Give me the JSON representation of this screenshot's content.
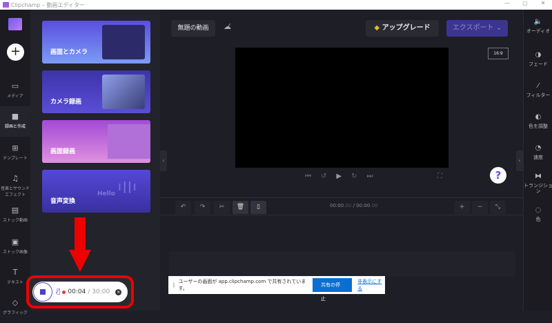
{
  "window": {
    "title": "Clipchamp – 動画エディター",
    "minimize": "—",
    "maximize": "▢",
    "close": "✕"
  },
  "nav": {
    "add": "+",
    "items": [
      {
        "label": "メディア",
        "icon": "▭"
      },
      {
        "label": "録画と作成",
        "icon": "■"
      },
      {
        "label": "テンプレート",
        "icon": "⊞"
      },
      {
        "label": "音楽とサウンドエフェクト",
        "icon": "♫"
      },
      {
        "label": "ストック動画",
        "icon": "▤"
      },
      {
        "label": "ストック画像",
        "icon": "▣"
      },
      {
        "label": "テキスト",
        "icon": "T"
      },
      {
        "label": "グラフィック",
        "icon": "◇"
      }
    ]
  },
  "panel": {
    "cards": [
      {
        "label": "画面とカメラ"
      },
      {
        "label": "カメラ録画"
      },
      {
        "label": "画面録画"
      },
      {
        "label": "音声変換",
        "thumb_text": "Hello"
      }
    ]
  },
  "header": {
    "project_title": "無題の動画",
    "upgrade": "アップグレード",
    "export": "エクスポート",
    "export_chevron": "⌄"
  },
  "preview": {
    "aspect_ratio": "16:9",
    "help": "?"
  },
  "timeline": {
    "current": "00:00",
    "current_frac": ".00",
    "divider": "/",
    "total": "00:00",
    "total_frac": ".00"
  },
  "right_sidebar": [
    {
      "label": "オーディオ",
      "icon": "🔈"
    },
    {
      "label": "フェード",
      "icon": "◑"
    },
    {
      "label": "フィルター",
      "icon": "⁄"
    },
    {
      "label": "色を調整",
      "icon": "◐"
    },
    {
      "label": "速度",
      "icon": "◔"
    },
    {
      "label": "トランジション",
      "icon": "⧓"
    },
    {
      "label": "色",
      "icon": "◌"
    }
  ],
  "share_bar": {
    "message": "ユーザーの画面が app.clipchamp.com で共有されています。",
    "stop": "共有の停止",
    "hide": "非表示にする"
  },
  "recorder": {
    "elapsed": "00:04",
    "separator": "/",
    "limit": "30:00"
  },
  "colors": {
    "accent": "#4b3fcf",
    "highlight": "#ee0000",
    "share_blue": "#0a6fd1"
  }
}
